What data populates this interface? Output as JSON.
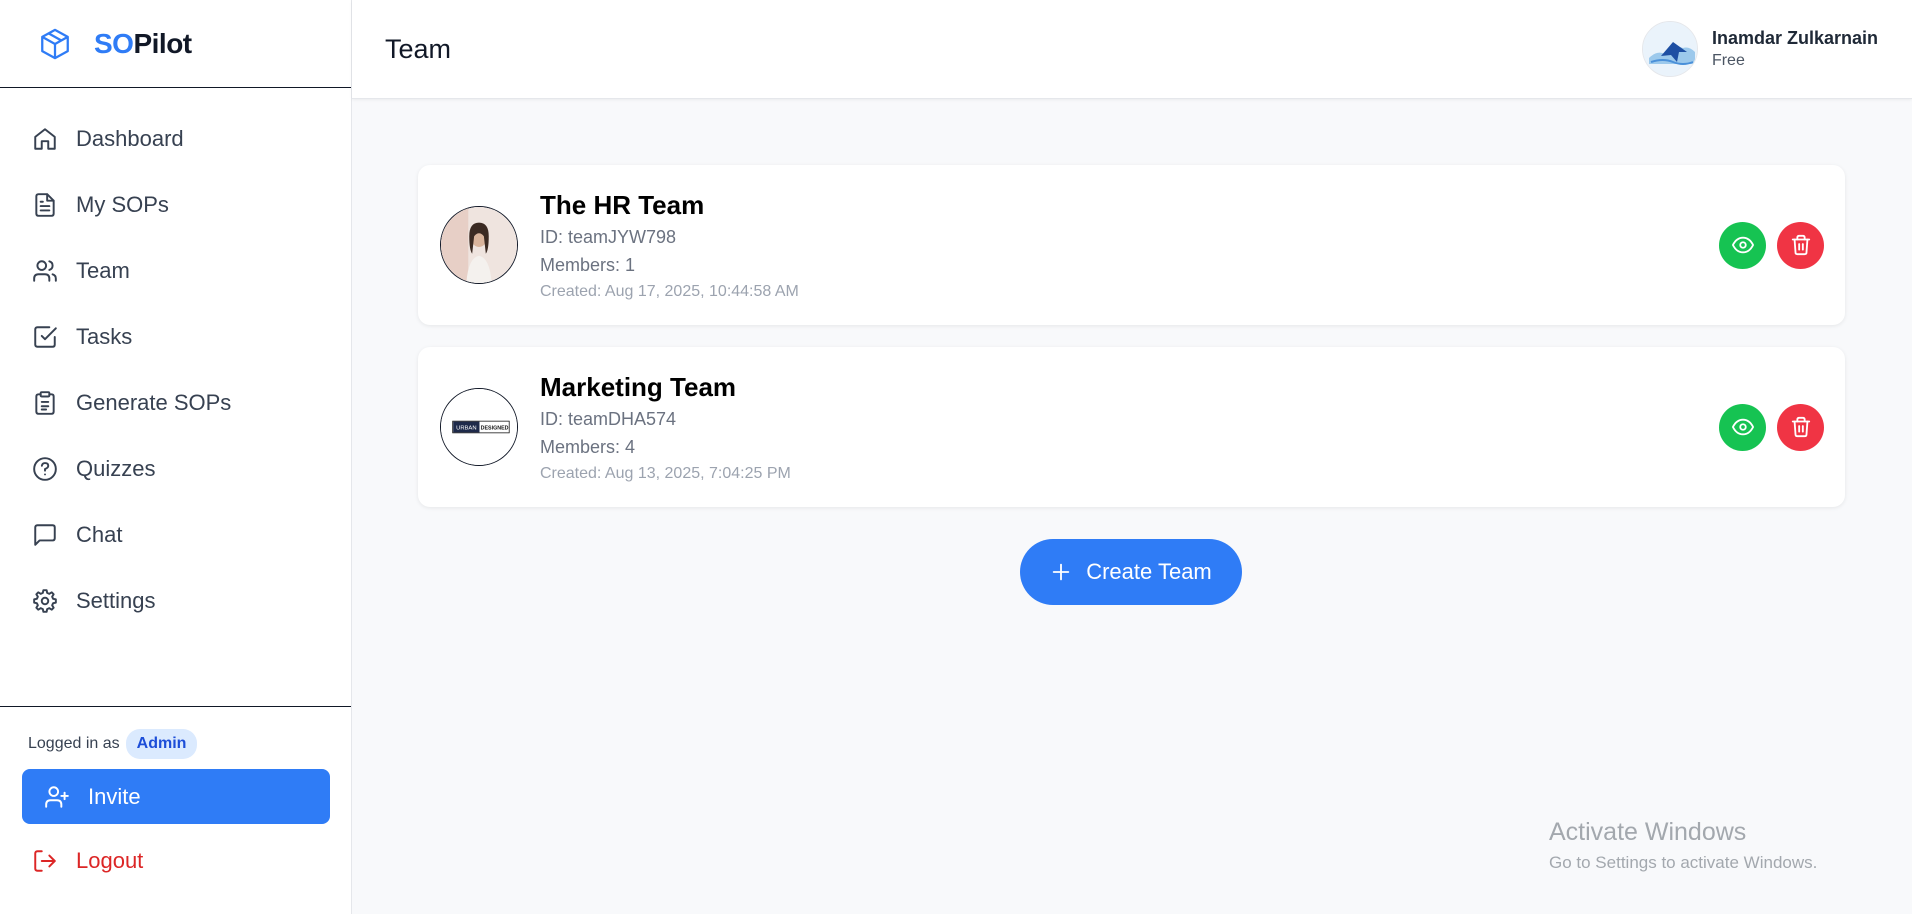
{
  "brand": {
    "prefix": "SO",
    "suffix": "Pilot"
  },
  "sidebar": {
    "items": [
      {
        "label": "Dashboard",
        "icon": "home-icon"
      },
      {
        "label": "My SOPs",
        "icon": "document-icon"
      },
      {
        "label": "Team",
        "icon": "users-icon"
      },
      {
        "label": "Tasks",
        "icon": "checkbox-icon"
      },
      {
        "label": "Generate SOPs",
        "icon": "clipboard-icon"
      },
      {
        "label": "Quizzes",
        "icon": "help-circle-icon"
      },
      {
        "label": "Chat",
        "icon": "message-icon"
      },
      {
        "label": "Settings",
        "icon": "gear-icon"
      }
    ],
    "logged_in_label": "Logged in as",
    "role": "Admin",
    "invite_label": "Invite",
    "logout_label": "Logout"
  },
  "header": {
    "title": "Team",
    "user_name": "Inamdar Zulkarnain",
    "user_plan": "Free"
  },
  "teams": [
    {
      "name": "The HR Team",
      "id_text": "ID: teamJYW798",
      "members_text": "Members: 1",
      "created_text": "Created: Aug 17, 2025, 10:44:58 AM"
    },
    {
      "name": "Marketing Team",
      "id_text": "ID: teamDHA574",
      "members_text": "Members: 4",
      "created_text": "Created: Aug 13, 2025, 7:04:25 PM",
      "logo_text_left": "URBAN",
      "logo_text_right": "DESIGNED"
    }
  ],
  "create_team_label": "Create Team",
  "watermark": {
    "title": "Activate Windows",
    "subtitle": "Go to Settings to activate Windows."
  },
  "colors": {
    "accent": "#2f7cf6",
    "view": "#16c352",
    "delete": "#f03444",
    "logout": "#dc2626"
  }
}
